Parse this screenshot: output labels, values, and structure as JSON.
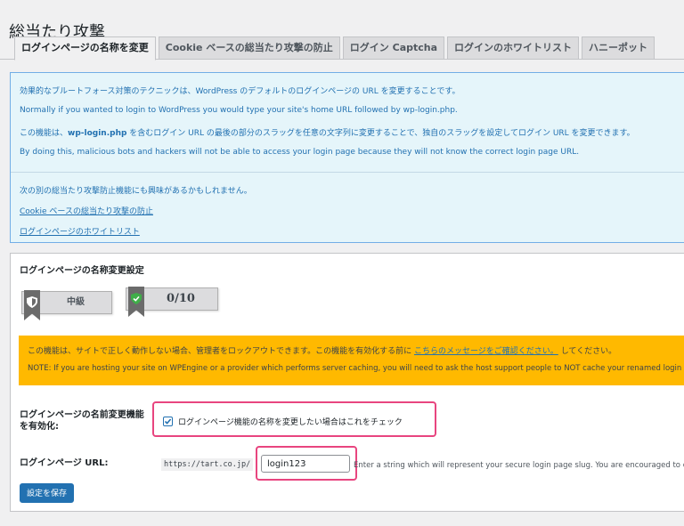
{
  "page": {
    "title": "総当たり攻撃"
  },
  "tabs": [
    {
      "label": "ログインページの名称を変更",
      "active": true
    },
    {
      "label": "Cookie ベースの総当たり攻撃の防止",
      "active": false
    },
    {
      "label": "ログイン Captcha",
      "active": false
    },
    {
      "label": "ログインのホワイトリスト",
      "active": false
    },
    {
      "label": "ハニーポット",
      "active": false
    }
  ],
  "info": {
    "line1": "効果的なブルートフォース対策のテクニックは、WordPress のデフォルトのログインページの URL を変更することです。",
    "line2": "Normally if you wanted to login to WordPress you would type your site's home URL followed by wp-login.php.",
    "line3_pre": "この機能は、",
    "line3_bold": "wp-login.php",
    "line3_post": " を含むログイン URL の最後の部分のスラッグを任意の文字列に変更することで、独自のスラッグを設定してログイン URL を変更できます。",
    "line4": "By doing this, malicious bots and hackers will not be able to access your login page because they will not know the correct login page URL.",
    "line5": "次の別の総当たり攻撃防止機能にも興味があるかもしれません。",
    "link1": "Cookie ベースの総当たり攻撃の防止",
    "link2": "ログインページのホワイトリスト"
  },
  "settings": {
    "title": "ログインページの名称変更設定",
    "badge_level": "中級",
    "badge_score": "0/10",
    "warn_pre": "この機能は、サイトで正しく動作しない場合、管理者をロックアウトできます。この機能を有効化する前に",
    "warn_link": "こちらのメッセージをご確認ください。",
    "warn_post": "してください。",
    "note": "NOTE: If you are hosting your site on WPEngine or a provider which performs server caching, you will need to ask the host support people to NOT cache your renamed login page",
    "enable_label_1": "ログインページの名前変更機能",
    "enable_label_2": "を有効化:",
    "checkbox_label": "ログインページ機能の名称を変更したい場合はこれをチェック",
    "checkbox_checked": true,
    "url_label": "ログインページ URL:",
    "url_prefix": "https://tart.co.jp/",
    "slug_value": "login123",
    "slug_hint": "Enter a string which will represent your secure login page slug. You are encouraged to choose",
    "save_label": "設定を保存"
  },
  "colors": {
    "accent": "#2271b1",
    "warning": "#ffb900",
    "highlight": "#e8457f",
    "info_bg": "#e5f5fa"
  },
  "icons": [
    "shield-icon",
    "shield-check-icon",
    "checkmark-icon"
  ]
}
